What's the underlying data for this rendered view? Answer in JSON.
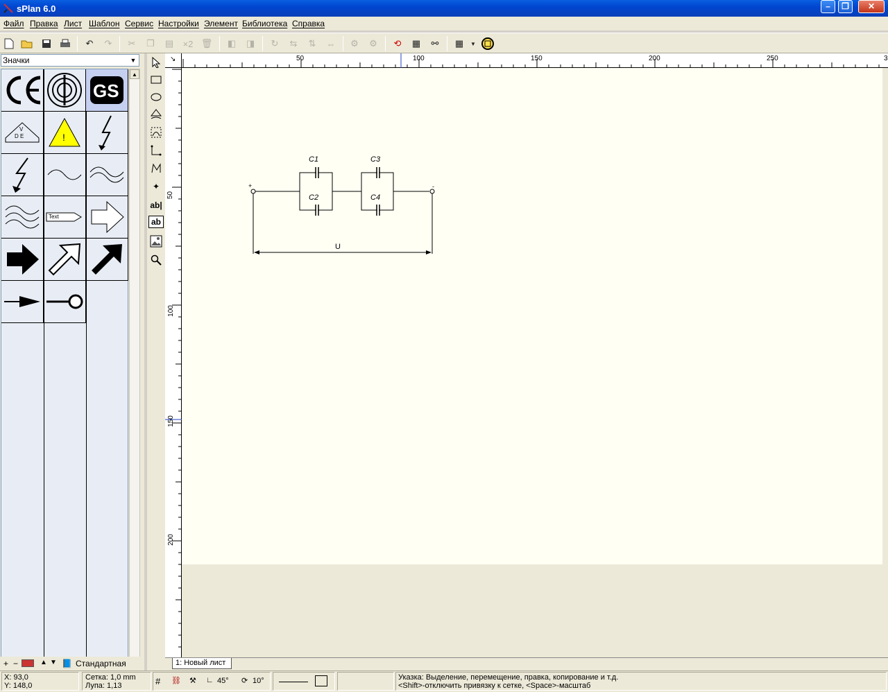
{
  "window": {
    "title": "sPlan 6.0"
  },
  "menu": [
    "Файл",
    "Правка",
    "Лист",
    "Шаблон",
    "Сервис",
    "Настройки",
    "Элемент",
    "Библиотека",
    "Справка"
  ],
  "toolbar": {
    "duplicate_label": "×2"
  },
  "library": {
    "category": "Значки",
    "group_name": "Стандартная",
    "symbols": [
      "CE mark",
      "TÜV radiation mark",
      "GS mark",
      "VDE mark",
      "Warning triangle",
      "Lightning bolt",
      "Lightning arrow",
      "AC wave",
      "Double wave",
      "Triple wave",
      "Text tag",
      "Outline arrow",
      "Filled arrow",
      "Outline diagonal arrow",
      "Filled diagonal arrow",
      "Arrow line",
      "Terminal circle"
    ],
    "text_tag_label": "Text",
    "selected": "GS mark"
  },
  "ruler": {
    "top_ticks": [
      "50",
      "100",
      "150",
      "200",
      "250",
      "3"
    ],
    "left_ticks": [
      "50",
      "100",
      "150",
      "200"
    ]
  },
  "schematic": {
    "labels": [
      "C1",
      "C2",
      "C3",
      "C4"
    ],
    "plus": "+",
    "minus": "-",
    "voltage": "U"
  },
  "sheet_tab": "1: Новый лист",
  "status": {
    "x": "X: 93,0",
    "y": "Y: 148,0",
    "grid": "Сетка:  1,0 mm",
    "zoom": "Лупа:   1,13",
    "angle1": "45°",
    "angle2": "10°",
    "hint1": "Указка: Выделение, перемещение, правка, копирование и т.д.",
    "hint2": "<Shift>-отключить привязку к сетке, <Space>-масштаб"
  },
  "colors": {
    "titlebar": "#0a4fd0",
    "sheet": "#fffff4",
    "library_bg": "#e8edf5",
    "selected_cell": "#c5d0f0"
  }
}
